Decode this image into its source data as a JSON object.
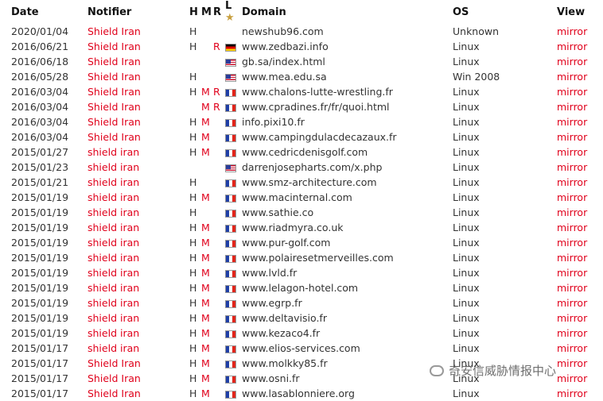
{
  "headers": {
    "date": "Date",
    "notifier": "Notifier",
    "h": "H",
    "m": "M",
    "r": "R",
    "l": "L",
    "star": "★",
    "domain": "Domain",
    "os": "OS",
    "view": "View"
  },
  "rows": [
    {
      "date": "2020/01/04",
      "notifier": "Shield Iran",
      "h": "H",
      "m": "",
      "r": "",
      "flag": "",
      "domain": "newshub96.com",
      "os": "Unknown",
      "view": "mirror"
    },
    {
      "date": "2016/06/21",
      "notifier": "Shield Iran",
      "h": "H",
      "m": "",
      "r": "R",
      "flag": "de",
      "domain": "www.zedbazi.info",
      "os": "Linux",
      "view": "mirror"
    },
    {
      "date": "2016/06/18",
      "notifier": "Shield Iran",
      "h": "",
      "m": "",
      "r": "",
      "flag": "us",
      "domain": "gb.sa/index.html",
      "os": "Linux",
      "view": "mirror"
    },
    {
      "date": "2016/05/28",
      "notifier": "Shield Iran",
      "h": "H",
      "m": "",
      "r": "",
      "flag": "us",
      "domain": "www.mea.edu.sa",
      "os": "Win 2008",
      "view": "mirror"
    },
    {
      "date": "2016/03/04",
      "notifier": "Shield Iran",
      "h": "H",
      "m": "M",
      "r": "R",
      "flag": "fr",
      "domain": "www.chalons-lutte-wrestling.fr",
      "os": "Linux",
      "view": "mirror"
    },
    {
      "date": "2016/03/04",
      "notifier": "Shield Iran",
      "h": "",
      "m": "M",
      "r": "R",
      "flag": "fr",
      "domain": "www.cpradines.fr/fr/quoi.html",
      "os": "Linux",
      "view": "mirror"
    },
    {
      "date": "2016/03/04",
      "notifier": "Shield Iran",
      "h": "H",
      "m": "M",
      "r": "",
      "flag": "fr",
      "domain": "info.pixi10.fr",
      "os": "Linux",
      "view": "mirror"
    },
    {
      "date": "2016/03/04",
      "notifier": "Shield Iran",
      "h": "H",
      "m": "M",
      "r": "",
      "flag": "fr",
      "domain": "www.campingdulacdecazaux.fr",
      "os": "Linux",
      "view": "mirror"
    },
    {
      "date": "2015/01/27",
      "notifier": "shield iran",
      "h": "H",
      "m": "M",
      "r": "",
      "flag": "fr",
      "domain": "www.cedricdenisgolf.com",
      "os": "Linux",
      "view": "mirror"
    },
    {
      "date": "2015/01/23",
      "notifier": "shield iran",
      "h": "",
      "m": "",
      "r": "",
      "flag": "us",
      "domain": "darrenjosepharts.com/x.php",
      "os": "Linux",
      "view": "mirror"
    },
    {
      "date": "2015/01/21",
      "notifier": "shield iran",
      "h": "H",
      "m": "",
      "r": "",
      "flag": "fr",
      "domain": "www.smz-architecture.com",
      "os": "Linux",
      "view": "mirror"
    },
    {
      "date": "2015/01/19",
      "notifier": "shield iran",
      "h": "H",
      "m": "M",
      "r": "",
      "flag": "fr",
      "domain": "www.macinternal.com",
      "os": "Linux",
      "view": "mirror"
    },
    {
      "date": "2015/01/19",
      "notifier": "shield iran",
      "h": "H",
      "m": "",
      "r": "",
      "flag": "fr",
      "domain": "www.sathie.co",
      "os": "Linux",
      "view": "mirror"
    },
    {
      "date": "2015/01/19",
      "notifier": "shield iran",
      "h": "H",
      "m": "M",
      "r": "",
      "flag": "fr",
      "domain": "www.riadmyra.co.uk",
      "os": "Linux",
      "view": "mirror"
    },
    {
      "date": "2015/01/19",
      "notifier": "shield iran",
      "h": "H",
      "m": "M",
      "r": "",
      "flag": "fr",
      "domain": "www.pur-golf.com",
      "os": "Linux",
      "view": "mirror"
    },
    {
      "date": "2015/01/19",
      "notifier": "shield iran",
      "h": "H",
      "m": "M",
      "r": "",
      "flag": "fr",
      "domain": "www.polairesetmerveilles.com",
      "os": "Linux",
      "view": "mirror"
    },
    {
      "date": "2015/01/19",
      "notifier": "shield iran",
      "h": "H",
      "m": "M",
      "r": "",
      "flag": "fr",
      "domain": "www.lvld.fr",
      "os": "Linux",
      "view": "mirror"
    },
    {
      "date": "2015/01/19",
      "notifier": "shield iran",
      "h": "H",
      "m": "M",
      "r": "",
      "flag": "fr",
      "domain": "www.lelagon-hotel.com",
      "os": "Linux",
      "view": "mirror"
    },
    {
      "date": "2015/01/19",
      "notifier": "shield iran",
      "h": "H",
      "m": "M",
      "r": "",
      "flag": "fr",
      "domain": "www.egrp.fr",
      "os": "Linux",
      "view": "mirror"
    },
    {
      "date": "2015/01/19",
      "notifier": "shield iran",
      "h": "H",
      "m": "M",
      "r": "",
      "flag": "fr",
      "domain": "www.deltavisio.fr",
      "os": "Linux",
      "view": "mirror"
    },
    {
      "date": "2015/01/19",
      "notifier": "shield iran",
      "h": "H",
      "m": "M",
      "r": "",
      "flag": "fr",
      "domain": "www.kezaco4.fr",
      "os": "Linux",
      "view": "mirror"
    },
    {
      "date": "2015/01/17",
      "notifier": "shield iran",
      "h": "H",
      "m": "M",
      "r": "",
      "flag": "fr",
      "domain": "www.elios-services.com",
      "os": "Linux",
      "view": "mirror"
    },
    {
      "date": "2015/01/17",
      "notifier": "Shield Iran",
      "h": "H",
      "m": "M",
      "r": "",
      "flag": "fr",
      "domain": "www.molkky85.fr",
      "os": "Linux",
      "view": "mirror"
    },
    {
      "date": "2015/01/17",
      "notifier": "Shield Iran",
      "h": "H",
      "m": "M",
      "r": "",
      "flag": "fr",
      "domain": "www.osni.fr",
      "os": "Linux",
      "view": "mirror"
    },
    {
      "date": "2015/01/17",
      "notifier": "Shield Iran",
      "h": "H",
      "m": "M",
      "r": "",
      "flag": "fr",
      "domain": "www.lasablonniere.org",
      "os": "Linux",
      "view": "mirror"
    }
  ],
  "watermark": "奇安信威胁情报中心",
  "colors": {
    "accent": "#e0001b",
    "text": "#333333"
  }
}
